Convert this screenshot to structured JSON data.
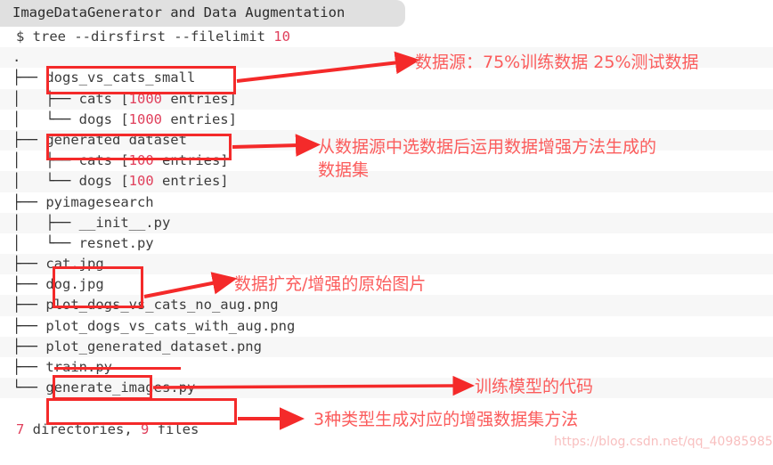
{
  "title": {
    "text": "ImageDataGenerator and Data Augmentation"
  },
  "terminal": {
    "command_line": {
      "prompt": "$ ",
      "command": "tree --dirsfirst --filelimit ",
      "arg": "10"
    },
    "root": ".",
    "lines": [
      {
        "tree": "├── ",
        "name": "dogs_vs_cats_small",
        "suffix": "",
        "count": ""
      },
      {
        "tree": "│   ├── ",
        "name": "cats [",
        "suffix": " entries]",
        "count": "1000"
      },
      {
        "tree": "│   └── ",
        "name": "dogs [",
        "suffix": " entries]",
        "count": "1000"
      },
      {
        "tree": "├── ",
        "name": "generated dataset",
        "suffix": "",
        "count": ""
      },
      {
        "tree": "│   ├── ",
        "name": "cats [",
        "suffix": " entries]",
        "count": "100"
      },
      {
        "tree": "│   └── ",
        "name": "dogs [",
        "suffix": " entries]",
        "count": "100"
      },
      {
        "tree": "├── ",
        "name": "pyimagesearch",
        "suffix": "",
        "count": ""
      },
      {
        "tree": "│   ├── ",
        "name": "__init__.py",
        "suffix": "",
        "count": ""
      },
      {
        "tree": "│   └── ",
        "name": "resnet.py",
        "suffix": "",
        "count": ""
      },
      {
        "tree": "├── ",
        "name": "cat.jpg",
        "suffix": "",
        "count": ""
      },
      {
        "tree": "├── ",
        "name": "dog.jpg",
        "suffix": "",
        "count": ""
      },
      {
        "tree": "├── ",
        "name": "plot_dogs_vs_cats_no_aug.png",
        "suffix": "",
        "count": ""
      },
      {
        "tree": "├── ",
        "name": "plot_dogs_vs_cats_with_aug.png",
        "suffix": "",
        "count": ""
      },
      {
        "tree": "├── ",
        "name": "plot_generated_dataset.png",
        "suffix": "",
        "count": ""
      },
      {
        "tree": "├── ",
        "name": "train.py",
        "suffix": "",
        "count": ""
      },
      {
        "tree": "└── ",
        "name": "generate_images.py",
        "suffix": "",
        "count": ""
      }
    ],
    "summary": {
      "dir_count": "7",
      "dir_label": " directories, ",
      "file_count": "9",
      "file_label": " files"
    }
  },
  "annotations": [
    {
      "id": "data-source",
      "text": "数据源：75%训练数据 25%测试数据"
    },
    {
      "id": "generated-dataset",
      "text": "从数据源中选数据后运用数据增强方法生成的\n数据集"
    },
    {
      "id": "source-images",
      "text": "数据扩充/增强的原始图片"
    },
    {
      "id": "train-code",
      "text": "训练模型的代码"
    },
    {
      "id": "generate-methods",
      "text": "3种类型生成对应的增强数据集方法"
    }
  ],
  "watermark": {
    "text": "https://blog.csdn.net/qq_40985985"
  },
  "colors": {
    "annotation_red": "#f42a2a",
    "note_text": "#fb5c5c",
    "number_red": "#e0405c",
    "title_bg": "#e0e0e0",
    "row_alt": "#f7f7f7"
  }
}
